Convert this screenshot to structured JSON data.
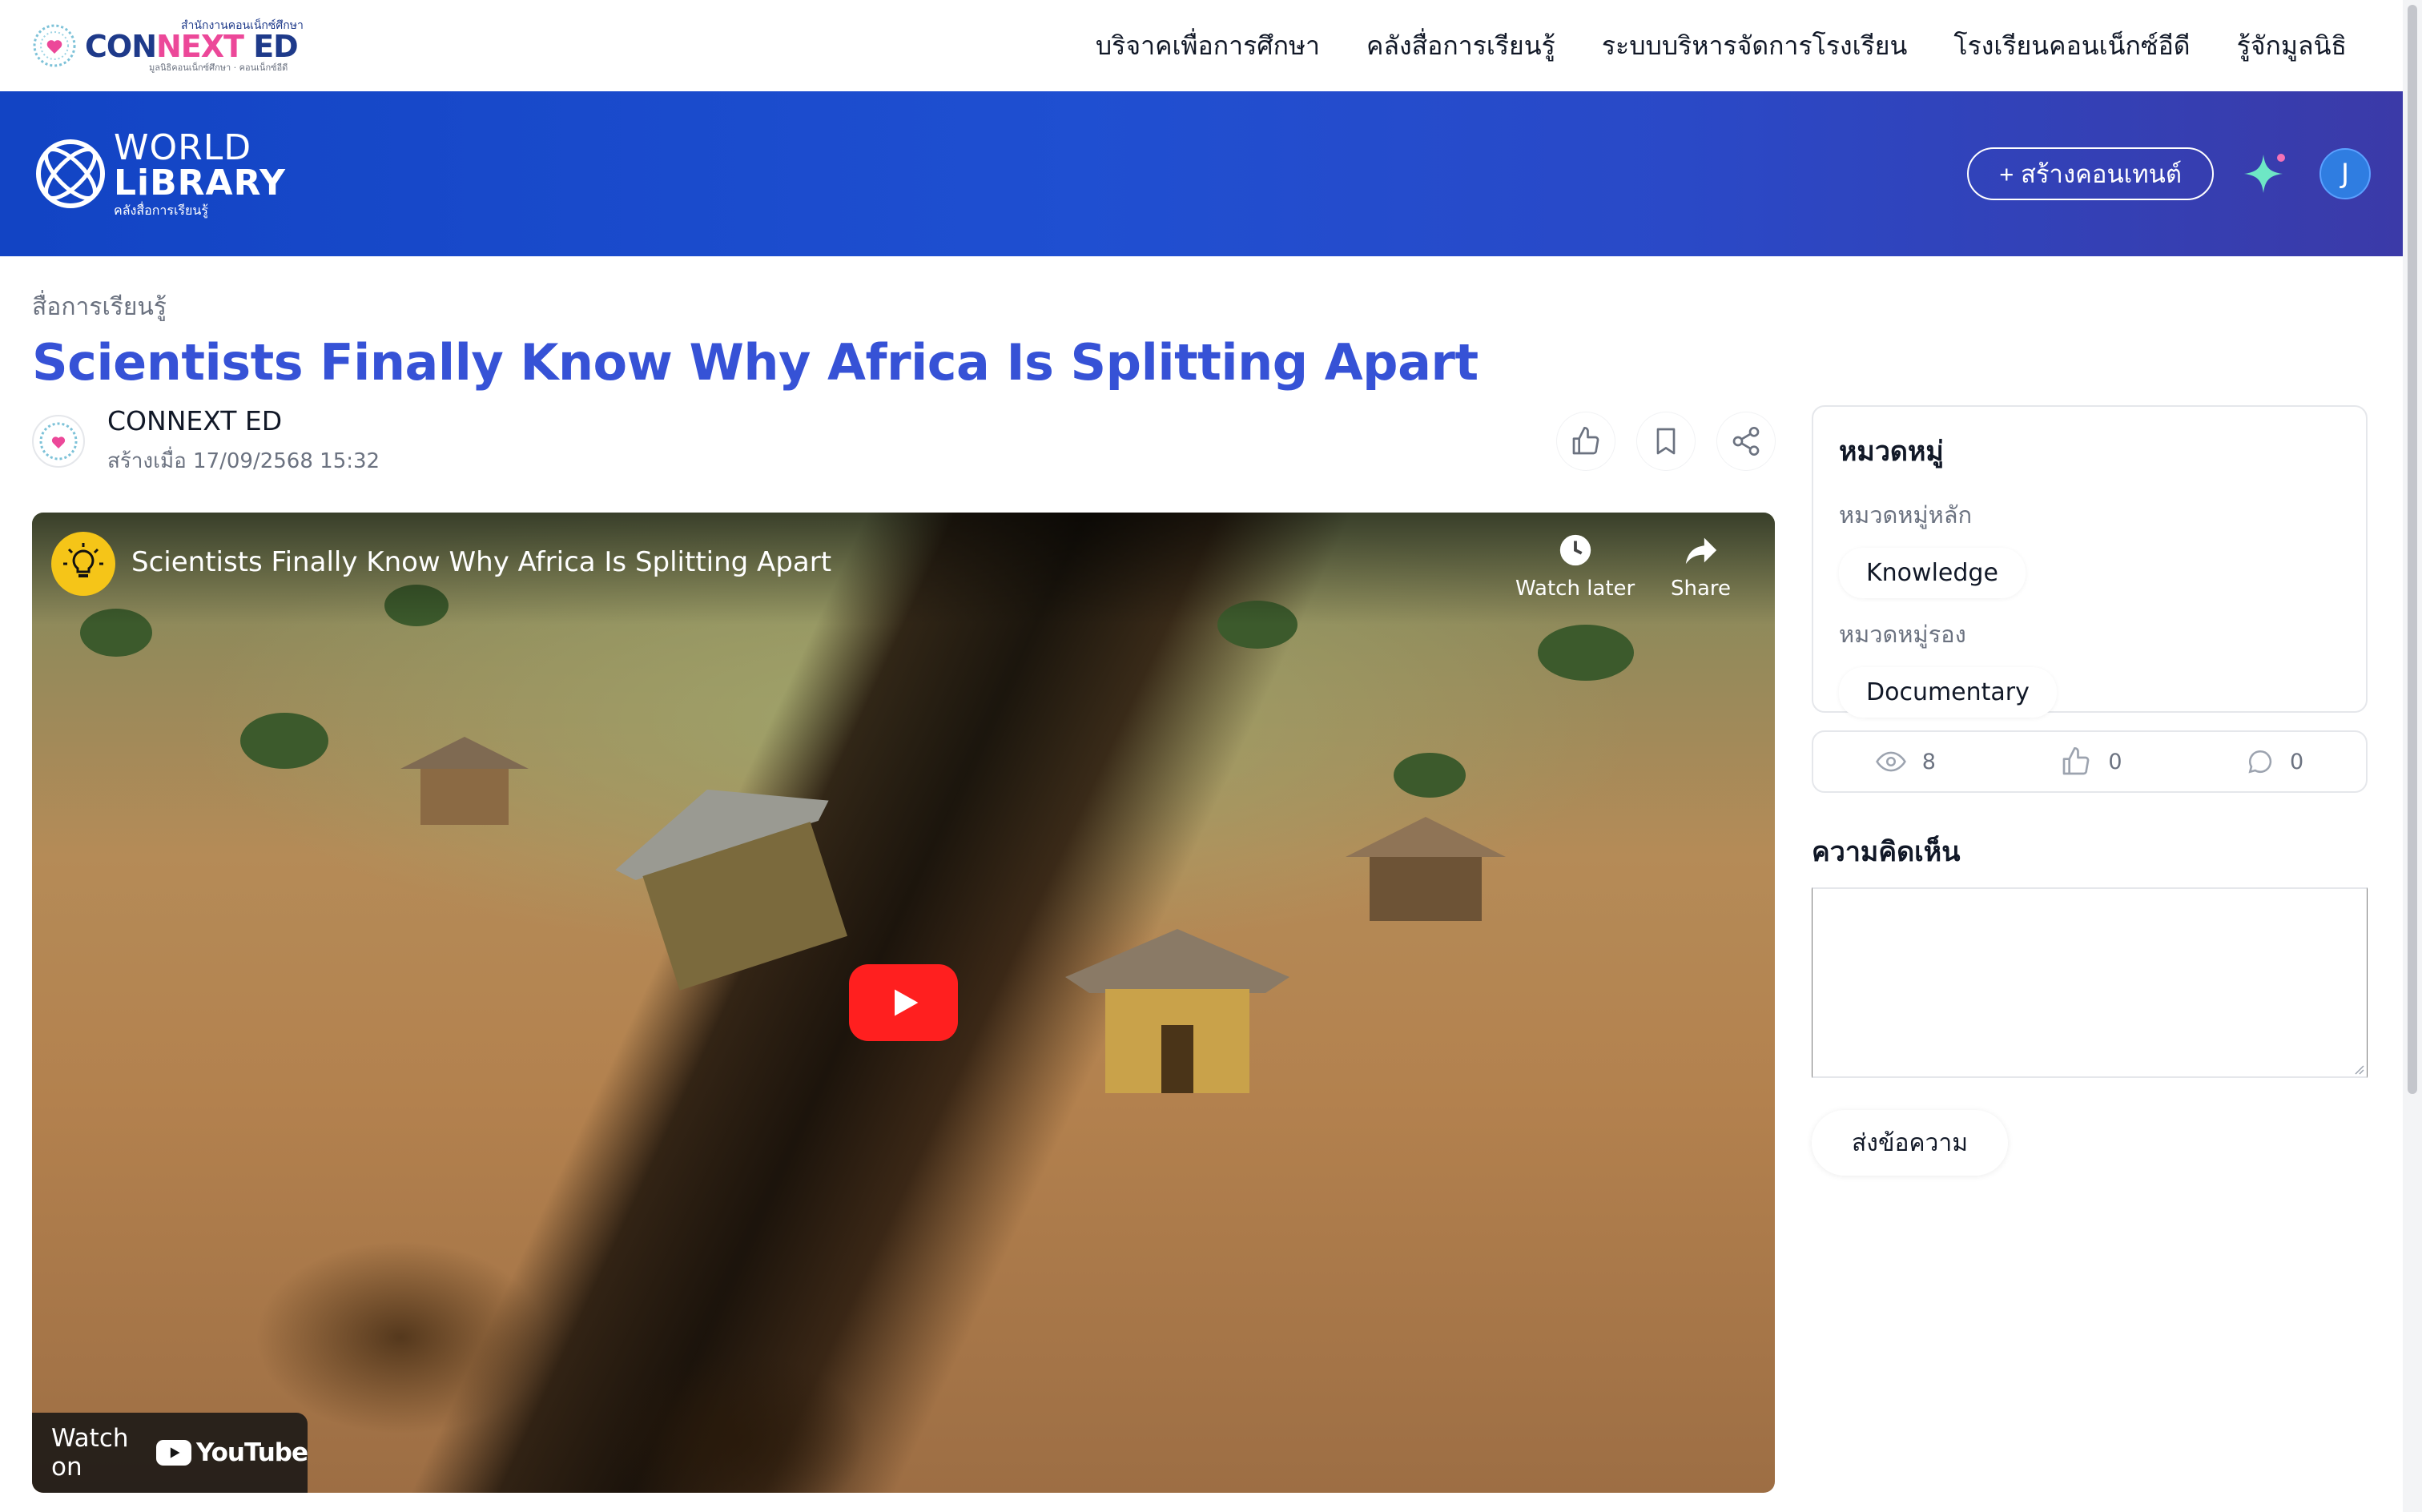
{
  "topnav": {
    "brand_small": "สำนักงานคอนเน็กซ์ศึกษา",
    "brand_name_a": "CON",
    "brand_name_b": "NEXT",
    "brand_name_c": " ED",
    "brand_tagline": "มูลนิธิคอนเน็กซ์ศึกษา · คอนเน็กซ์อีดี",
    "links": [
      "บริจาคเพื่อการศึกษา",
      "คลังสื่อการเรียนรู้",
      "ระบบบริหารจัดการโรงเรียน",
      "โรงเรียนคอนเน็กซ์อีดี",
      "รู้จักมูลนิธิ"
    ]
  },
  "band": {
    "logo_line1": "WORLD",
    "logo_line2": "LiBRARY",
    "logo_sub": "คลังสื่อการเรียนรู้",
    "create_label": "+ สร้างคอนเทนต์",
    "avatar_letter": "J",
    "colors": {
      "gradient_start": "#1244c4",
      "gradient_end": "#3b3aa8"
    }
  },
  "breadcrumb": "สื่อการเรียนรู้",
  "title": "Scientists Finally Know Why Africa Is Splitting Apart",
  "author": {
    "name": "CONNEXT ED",
    "created": "สร้างเมื่อ 17/09/2568 15:32"
  },
  "video": {
    "title": "Scientists Finally Know Why Africa Is Splitting Apart",
    "watch_later": "Watch later",
    "share": "Share",
    "watch_on": "Watch on",
    "youtube": "YouTube"
  },
  "sidebar": {
    "categories_title": "หมวดหมู่",
    "main_label": "หมวดหมู่หลัก",
    "main_value": "Knowledge",
    "sub_label": "หมวดหมู่รอง",
    "sub_value": "Documentary",
    "views": "8",
    "likes": "0",
    "comments": "0",
    "comments_heading": "ความคิดเห็น",
    "comment_placeholder": "",
    "send_label": "ส่งข้อความ"
  },
  "icons": [
    "heart-logo-icon",
    "world-library-icon",
    "sparkle-icon",
    "like-icon",
    "bookmark-icon",
    "share-icon",
    "lightbulb-icon",
    "clock-icon",
    "share-arrow-icon",
    "play-icon",
    "youtube-icon",
    "eye-icon",
    "comment-icon"
  ],
  "accent_color": "#3652d6"
}
